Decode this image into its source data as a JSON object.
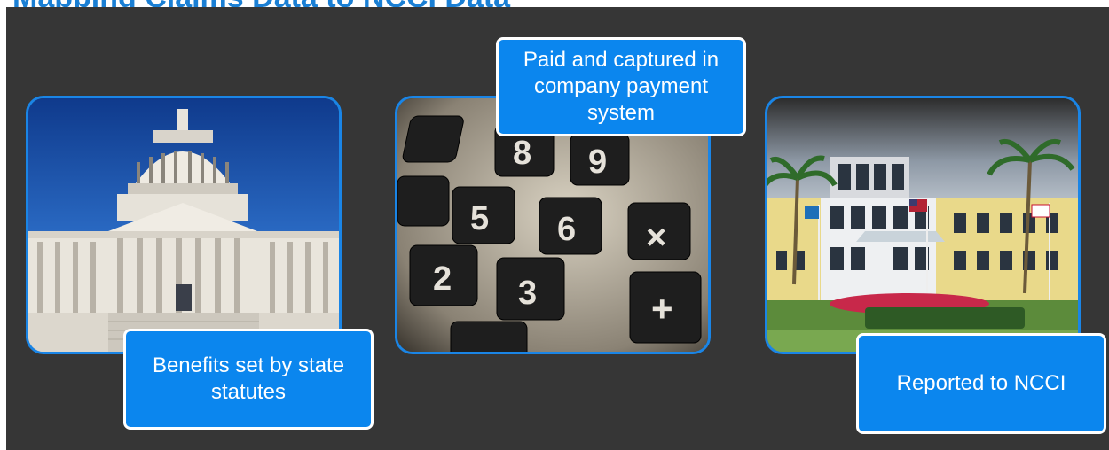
{
  "title": "Mapping Claims Data to NCCI Data",
  "panels": [
    {
      "caption": "Benefits set by state statutes",
      "image": "us-capitol-building"
    },
    {
      "caption": "Paid and captured in company payment system",
      "image": "calculator-keypad"
    },
    {
      "caption": "Reported to NCCI",
      "image": "ncci-headquarters-building"
    }
  ],
  "colors": {
    "background": "#363636",
    "accent": "#0b86ee",
    "border": "#1a85e6",
    "title": "#1a7fd4"
  }
}
